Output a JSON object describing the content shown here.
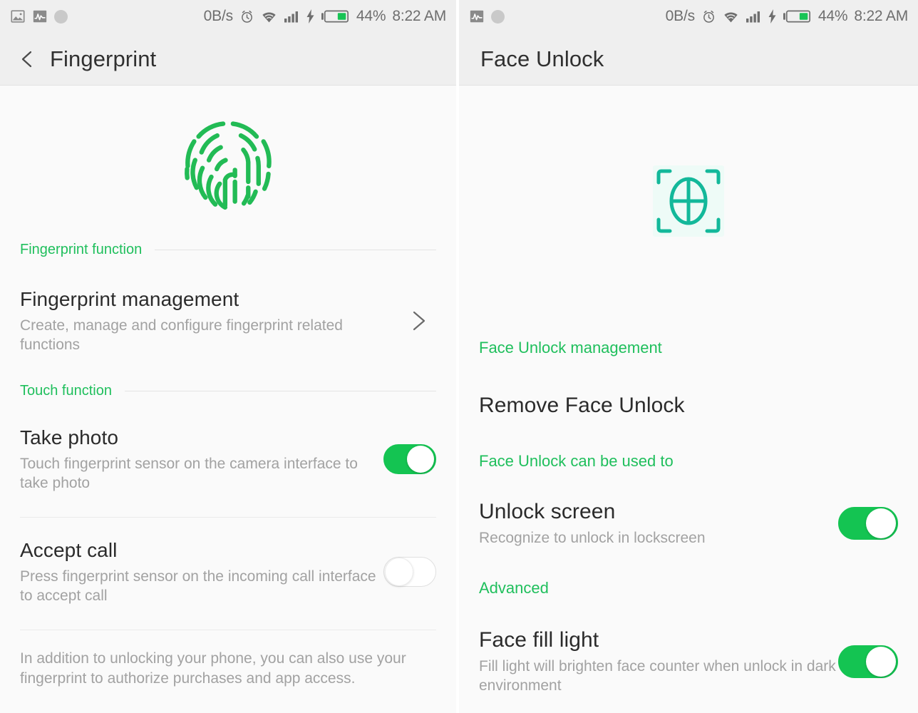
{
  "statusbar": {
    "left_icons_panel1": [
      "image-icon",
      "activity-chart-icon",
      "gray-circle-icon"
    ],
    "left_icons_panel2": [
      "activity-chart-icon",
      "gray-circle-icon"
    ],
    "data_rate": "0B/s",
    "icons": [
      "alarm-clock-icon",
      "wifi-icon",
      "signal-bars-icon",
      "charging-bolt-icon",
      "battery-icon"
    ],
    "battery_percent": "44%",
    "time": "8:22 AM"
  },
  "colors": {
    "accent_green": "#1fbf5c",
    "toggle_on": "#14c452",
    "fingerprint_green": "#22bb55",
    "face_teal": "#13b89a",
    "title_text": "#303030",
    "sub_text": "#a2a2a2"
  },
  "fingerprint_screen": {
    "title": "Fingerprint",
    "back_icon": "chevron-left-icon",
    "hero_icon": "fingerprint-icon",
    "sections": [
      {
        "label": "Fingerprint function",
        "rows": [
          {
            "title": "Fingerprint management",
            "subtitle": "Create, manage and configure fingerprint related functions",
            "control": "chevron-right-icon"
          }
        ]
      },
      {
        "label": "Touch function",
        "rows": [
          {
            "title": "Take photo",
            "subtitle": "Touch fingerprint sensor on the camera interface to take photo",
            "control": "toggle",
            "state": "on"
          },
          {
            "title": "Accept call",
            "subtitle": "Press fingerprint sensor on the incoming call interface to accept call",
            "control": "toggle",
            "state": "off"
          }
        ]
      }
    ],
    "footnote": "In addition to unlocking your phone, you can also use your fingerprint to authorize purchases and app access."
  },
  "face_unlock_screen": {
    "title": "Face Unlock",
    "hero_icon": "face-scan-icon",
    "management_label": "Face Unlock management",
    "remove_label": "Remove Face Unlock",
    "can_be_used_label": "Face Unlock can be used to",
    "unlock_row": {
      "title": "Unlock screen",
      "subtitle": "Recognize to unlock in lockscreen",
      "control": "toggle",
      "state": "on"
    },
    "advanced_label": "Advanced",
    "fill_light_row": {
      "title": "Face fill light",
      "subtitle": "Fill light will brighten face counter when unlock in dark environment",
      "control": "toggle",
      "state": "on"
    }
  }
}
